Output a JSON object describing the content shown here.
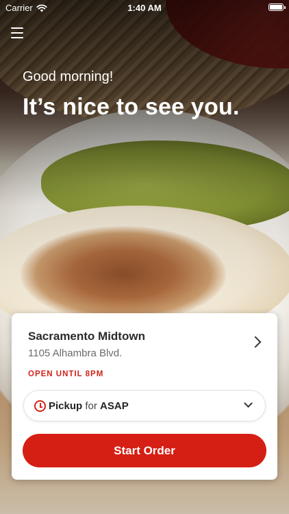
{
  "status_bar": {
    "carrier": "Carrier",
    "time": "1:40 AM",
    "wifi_icon": "wifi-icon",
    "battery_icon": "battery-icon"
  },
  "header": {
    "menu_icon": "hamburger-menu-icon",
    "greeting": "Good morning!",
    "headline": "It’s nice to see you."
  },
  "location_card": {
    "name": "Sacramento Midtown",
    "address": "1105 Alhambra Blvd.",
    "open_status": "OPEN UNTIL 8PM",
    "chevron_icon": "chevron-right-icon",
    "order_type": {
      "mode": "Pickup",
      "for_word": "for",
      "time": "ASAP",
      "clock_icon": "clock-icon",
      "dropdown_icon": "chevron-down-icon"
    },
    "start_button": "Start Order"
  },
  "colors": {
    "accent_red": "#d61f14",
    "status_red": "#d0231a"
  }
}
